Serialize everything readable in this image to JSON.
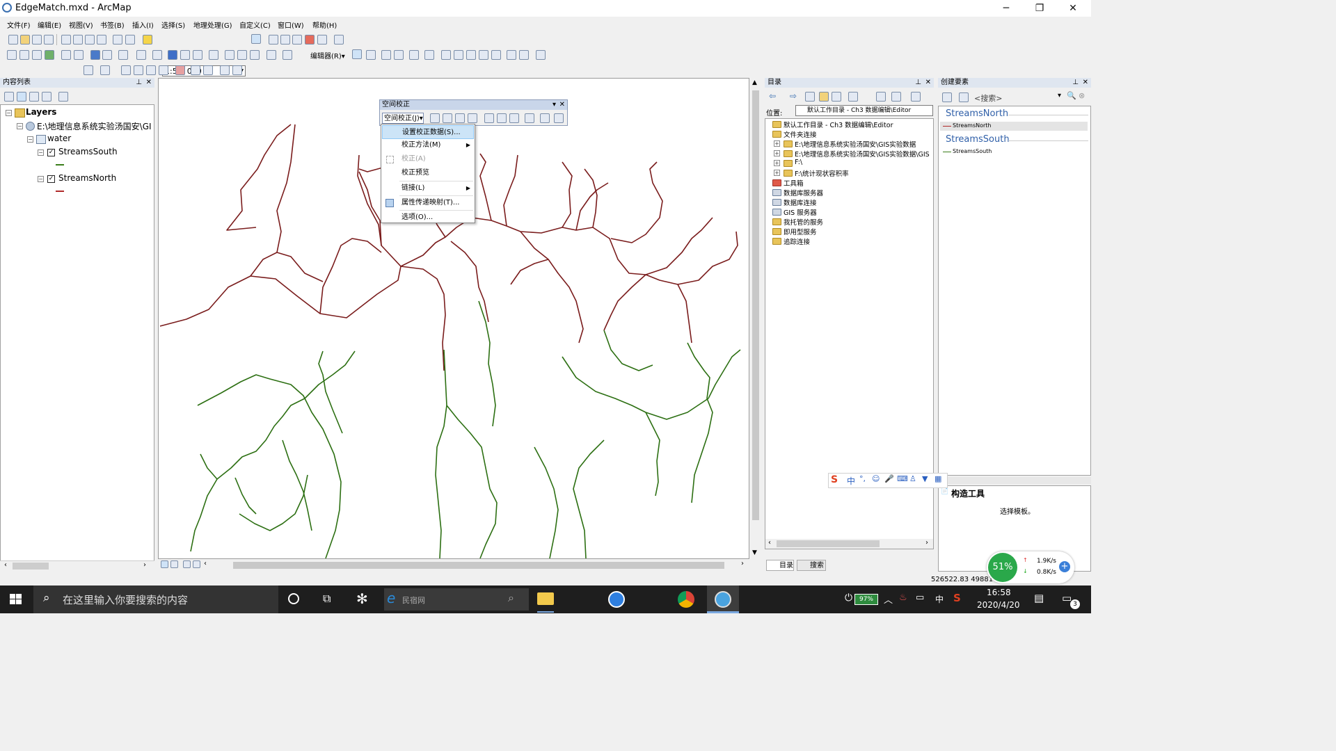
{
  "window": {
    "title": "EdgeMatch.mxd - ArcMap",
    "min": "─",
    "max": "❐",
    "close": "✕"
  },
  "menu": [
    "文件(F)",
    "编辑(E)",
    "视图(V)",
    "书签(B)",
    "插入(I)",
    "选择(S)",
    "地理处理(G)",
    "自定义(C)",
    "窗口(W)",
    "帮助(H)"
  ],
  "toolbar": {
    "scale": "1:50, 000",
    "editor_label": "编辑器(R)▾"
  },
  "toc": {
    "title": "内容列表",
    "layers_label": "Layers",
    "path_label": "E:\\地理信息系统实验汤国安\\GI",
    "group_label": "water",
    "layer1": "StreamsSouth",
    "layer2": "StreamsNorth",
    "layer1_color": "#3a7d1a",
    "layer2_color": "#b02a2a"
  },
  "spatial_adjust": {
    "title": "空间校正",
    "menu_button": "空间校正(J)▾",
    "items": [
      "设置校正数据(S)...",
      "校正方法(M)",
      "校正(A)",
      "校正预览",
      "链接(L)",
      "属性传递映射(T)...",
      "选项(O)..."
    ]
  },
  "catalog": {
    "title": "目录",
    "location_label": "位置:",
    "location_value": "默认工作目录 - Ch3 数据编辑\\Editor",
    "items": [
      "默认工作目录 - Ch3 数据编辑\\Editor",
      "文件夹连接",
      "E:\\地理信息系统实验汤国安\\GIS实验数据",
      "E:\\地理信息系统实验汤国安\\GIS实验数据\\GIS",
      "F:\\",
      "F:\\统计现状容积率",
      "工具箱",
      "数据库服务器",
      "数据库连接",
      "GIS 服务器",
      "我托管的服务",
      "即用型服务",
      "追踪连接"
    ],
    "tab_catalog": "目录",
    "tab_search": "搜索"
  },
  "create_features": {
    "title": "创建要素",
    "search_placeholder": "<搜索>",
    "template1": "StreamsNorth",
    "template1_sub": "StreamsNorth",
    "template2": "StreamsSouth",
    "template2_sub": "StreamsSouth",
    "construct_title": "构造工具",
    "construct_hint": "选择模板。"
  },
  "status": {
    "coords": "526522.83  4988141",
    "net_up": "1.9K/s",
    "net_down": "0.8K/s",
    "cpu": "51%"
  },
  "taskbar": {
    "search_placeholder": "在这里输入你要搜索的内容",
    "browser_box": "民宿网",
    "battery": "97%",
    "ime": "中",
    "time": "16:58",
    "date": "2020/4/20",
    "notif_count": "3"
  }
}
